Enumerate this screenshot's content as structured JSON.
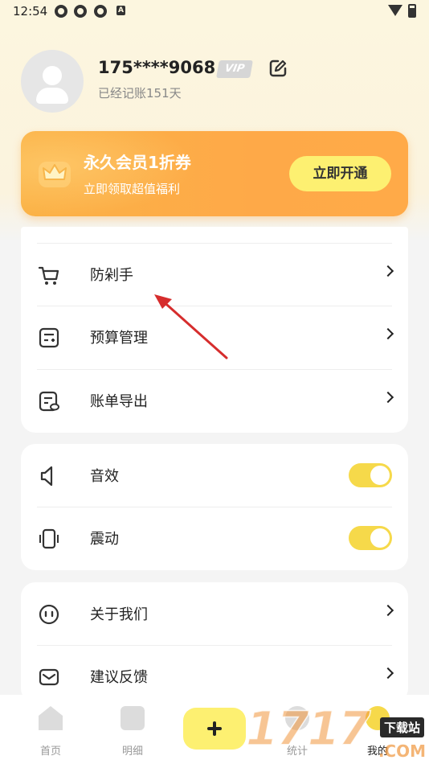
{
  "status_bar": {
    "time": "12:54",
    "notification_icons": [
      "app-icon",
      "app-icon",
      "app-icon",
      "a-icon"
    ],
    "a_glyph": "A",
    "system_icons": [
      "wifi-icon",
      "battery-icon"
    ]
  },
  "profile": {
    "phone": "175****9068",
    "vip_label": "VIP",
    "days_text": "已经记账151天"
  },
  "promo": {
    "title": "永久会员1折券",
    "subtitle": "立即领取超值福利",
    "button": "立即开通"
  },
  "card_tools": {
    "items": [
      {
        "label": "防剁手",
        "icon": "cart-icon"
      },
      {
        "label": "预算管理",
        "icon": "budget-icon"
      },
      {
        "label": "账单导出",
        "icon": "export-icon"
      }
    ]
  },
  "card_settings": {
    "items": [
      {
        "label": "音效",
        "icon": "speaker-icon",
        "on": true
      },
      {
        "label": "震动",
        "icon": "vibrate-icon",
        "on": true
      }
    ]
  },
  "card_about": {
    "items": [
      {
        "label": "关于我们",
        "icon": "smile-icon"
      },
      {
        "label": "建议反馈",
        "icon": "mail-icon"
      }
    ]
  },
  "tabbar": {
    "tabs": [
      {
        "label": "首页",
        "icon": "home-icon"
      },
      {
        "label": "明细",
        "icon": "list-icon"
      },
      {
        "label": "",
        "icon": "plus-icon"
      },
      {
        "label": "统计",
        "icon": "chart-icon"
      },
      {
        "label": "我的",
        "icon": "mine-icon"
      }
    ]
  },
  "watermark": {
    "digits": "1717",
    "site": "下载站",
    "domain": ".COM"
  },
  "colors": {
    "accent_yellow": "#fdf071",
    "toggle_on": "#f6d94a",
    "promo_orange": "#fea948",
    "annotation_red": "#d62d2d"
  }
}
